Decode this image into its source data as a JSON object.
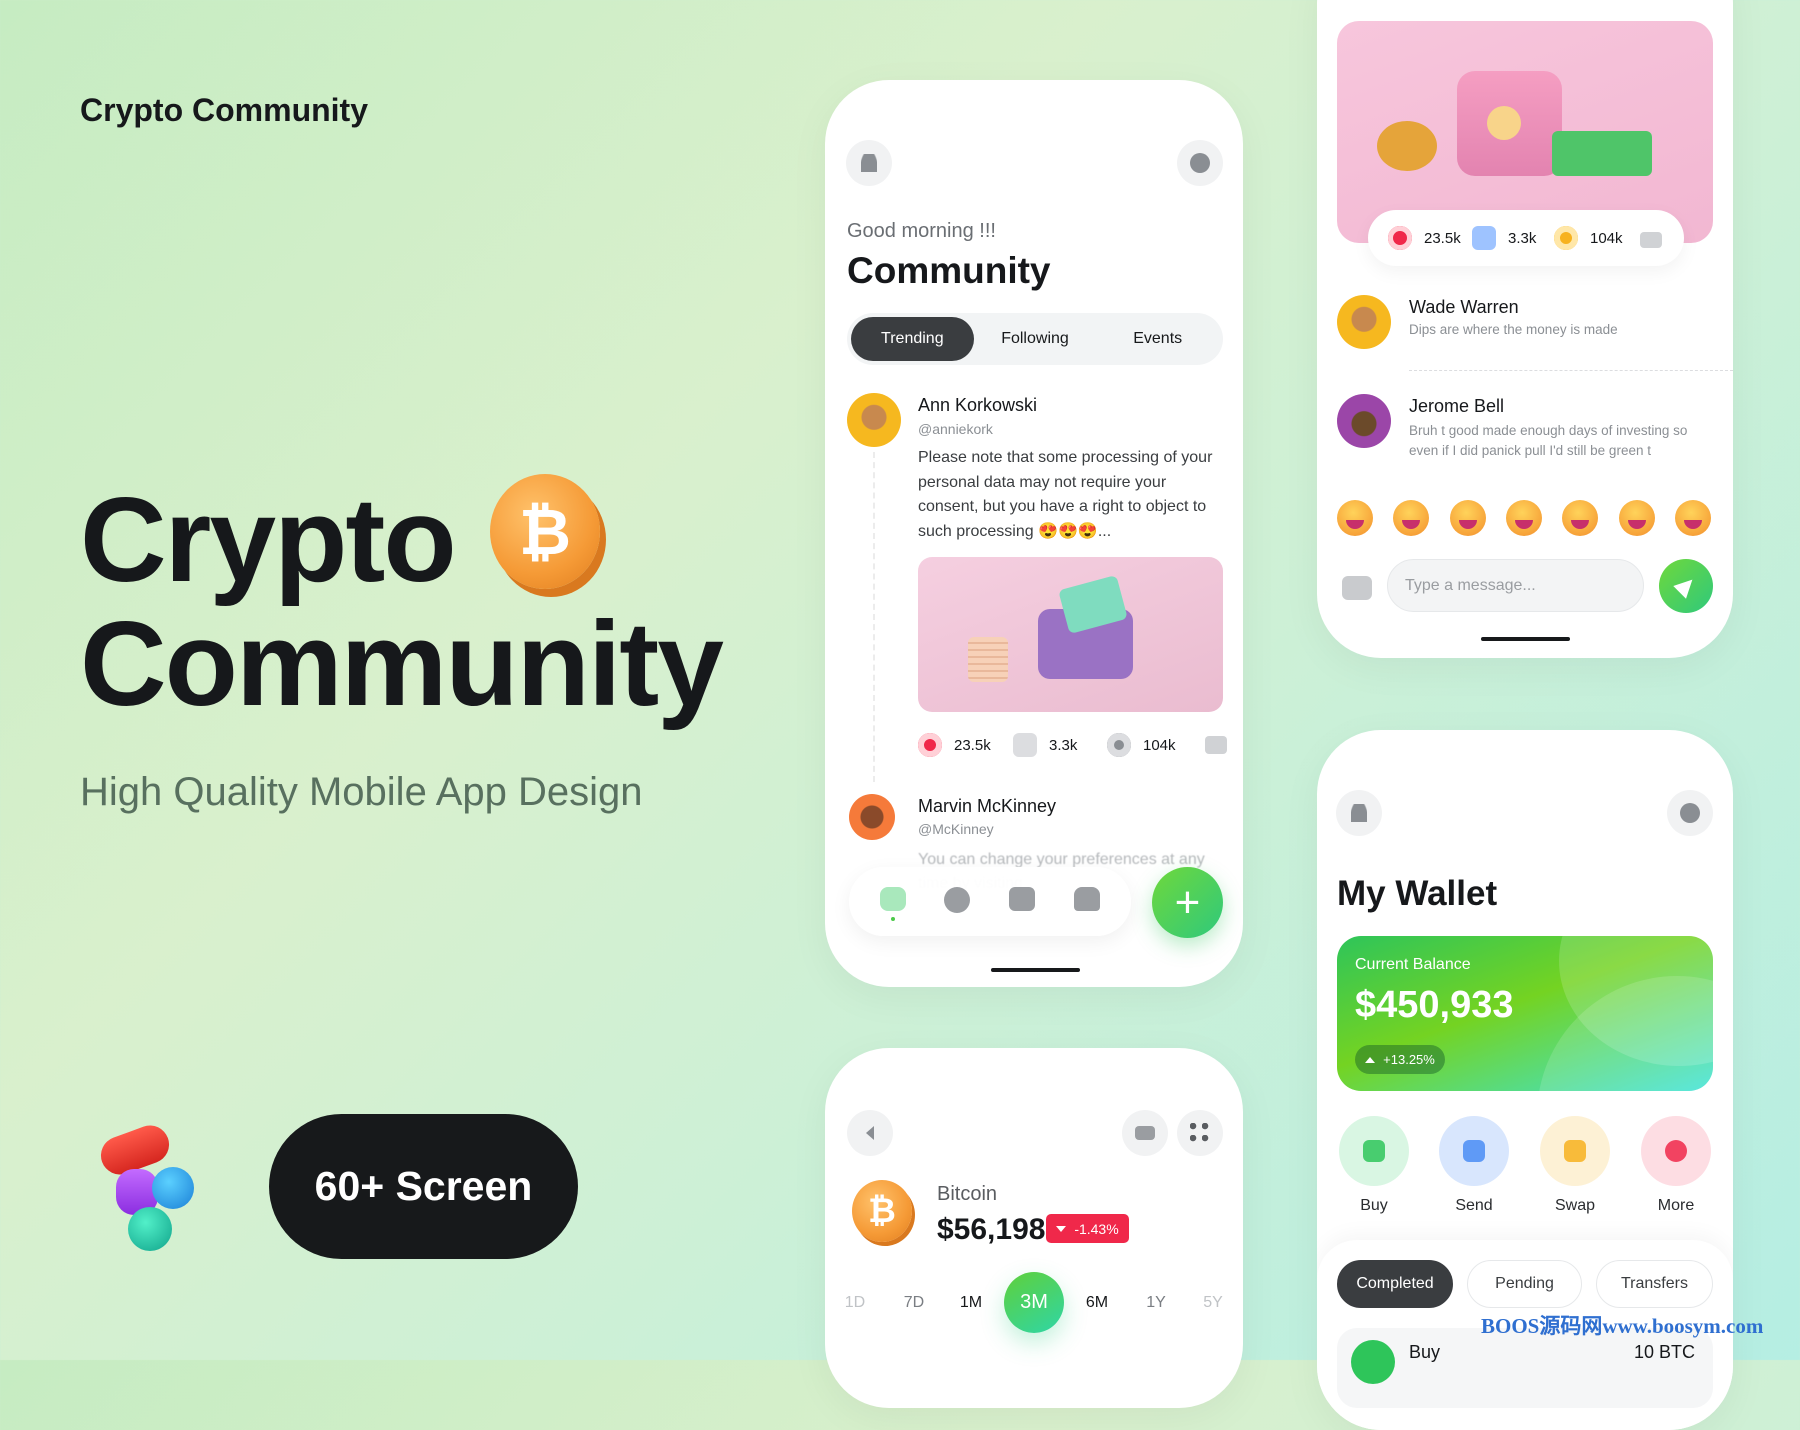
{
  "brand": {
    "small_title": "Crypto Community",
    "hero_line1": "Crypto",
    "hero_line2": "Community",
    "subtitle": "High Quality Mobile App Design",
    "coin_symbol": "₿",
    "screens_label": "60+ Screen"
  },
  "community": {
    "greeting": "Good morning !!!",
    "title": "Community",
    "tabs": [
      {
        "label": "Trending",
        "active": true
      },
      {
        "label": "Following"
      },
      {
        "label": "Events"
      }
    ],
    "posts": [
      {
        "name": "Ann Korkowski",
        "handle": "@anniekork",
        "text": "Please note that some processing of your personal data may not require your consent, but you have a right to object to such processing 😍😍😍...",
        "likes": "23.5k",
        "comments": "3.3k",
        "views": "104k"
      },
      {
        "name": "Marvin McKinney",
        "handle": "@McKinney",
        "text": "You can change your preferences at any time by visiting"
      }
    ],
    "nav": [
      "home-icon",
      "explore-icon",
      "chat-icon",
      "wallet-icon"
    ],
    "fab": "+"
  },
  "coin": {
    "name": "Bitcoin",
    "price": "$56,198",
    "change": "-1.43%",
    "ranges": [
      "1D",
      "7D",
      "1M",
      "3M",
      "6M",
      "1Y",
      "5Y"
    ],
    "active_range": "3M"
  },
  "chat": {
    "stats": {
      "likes": "23.5k",
      "comments": "3.3k",
      "coins": "104k"
    },
    "messages": [
      {
        "name": "Wade Warren",
        "text": "Dips are where the money is made"
      },
      {
        "name": "Jerome Bell",
        "text": "Bruh t good made enough days of investing so even if I did panick pull I'd still be green t"
      }
    ],
    "emoji_count": 7,
    "input_placeholder": "Type a message..."
  },
  "wallet": {
    "title": "My Wallet",
    "balance_label": "Current Balance",
    "balance": "$450,933",
    "change": "+13.25%",
    "actions": [
      {
        "label": "Buy",
        "color": "#d9f6e3"
      },
      {
        "label": "Send",
        "color": "#d8e6fd"
      },
      {
        "label": "Swap",
        "color": "#fdf1d5"
      },
      {
        "label": "More",
        "color": "#fddde3"
      }
    ],
    "filters": [
      {
        "label": "Completed",
        "active": true
      },
      {
        "label": "Pending"
      },
      {
        "label": "Transfers"
      }
    ],
    "transaction": {
      "type": "Buy",
      "amount": "10 BTC"
    }
  },
  "watermark": "BOOS源码网www.boosym.com",
  "colors": {
    "accent_green": "#4cc94a",
    "negative": "#f0284a",
    "dark": "#17191b"
  }
}
